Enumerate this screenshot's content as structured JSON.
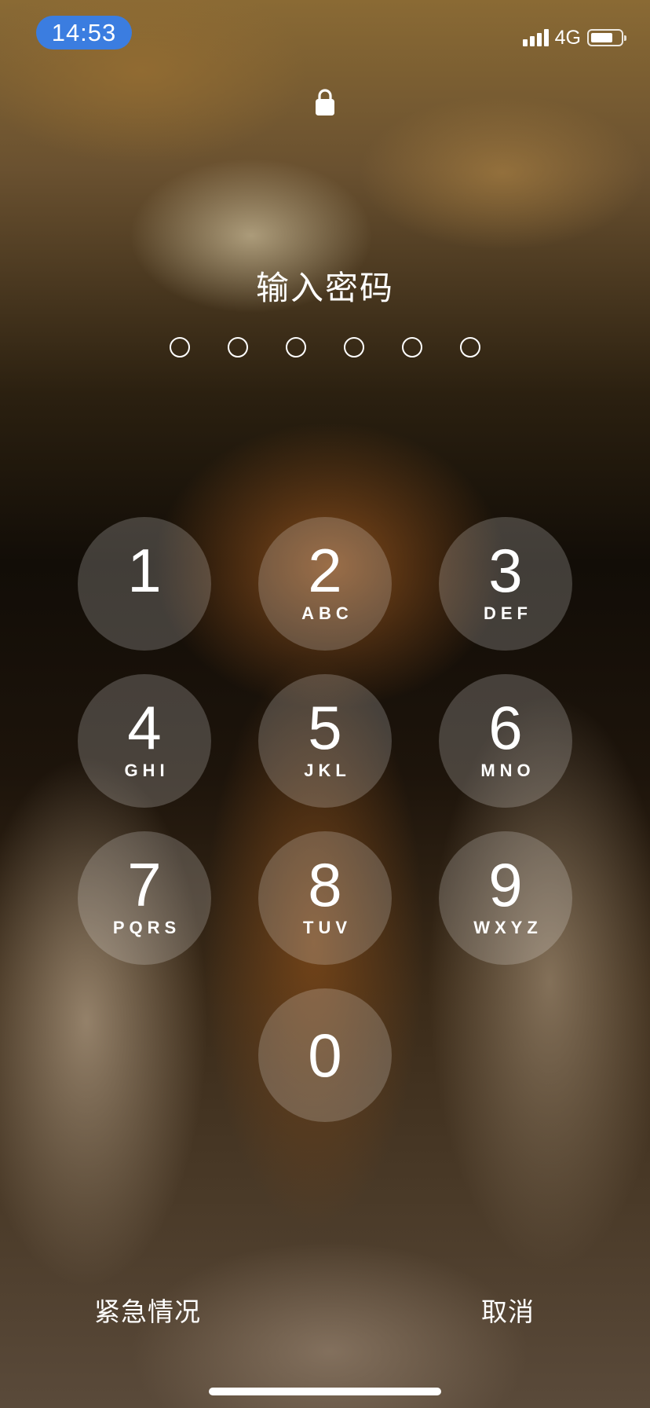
{
  "status_bar": {
    "time": "14:53",
    "time_pill_color": "#3b7de0",
    "network": "4G",
    "signal_bars": 4,
    "battery_level": 0.75
  },
  "lock_icon": "lock-icon",
  "passcode": {
    "prompt": "输入密码",
    "digits_total": 6,
    "digits_entered": 0
  },
  "keypad": [
    {
      "digit": "1",
      "letters": ""
    },
    {
      "digit": "2",
      "letters": "ABC"
    },
    {
      "digit": "3",
      "letters": "DEF"
    },
    {
      "digit": "4",
      "letters": "GHI"
    },
    {
      "digit": "5",
      "letters": "JKL"
    },
    {
      "digit": "6",
      "letters": "MNO"
    },
    {
      "digit": "7",
      "letters": "PQRS"
    },
    {
      "digit": "8",
      "letters": "TUV"
    },
    {
      "digit": "9",
      "letters": "WXYZ"
    },
    {
      "digit": "0",
      "letters": ""
    }
  ],
  "bottom": {
    "emergency_label": "紧急情况",
    "cancel_label": "取消"
  }
}
